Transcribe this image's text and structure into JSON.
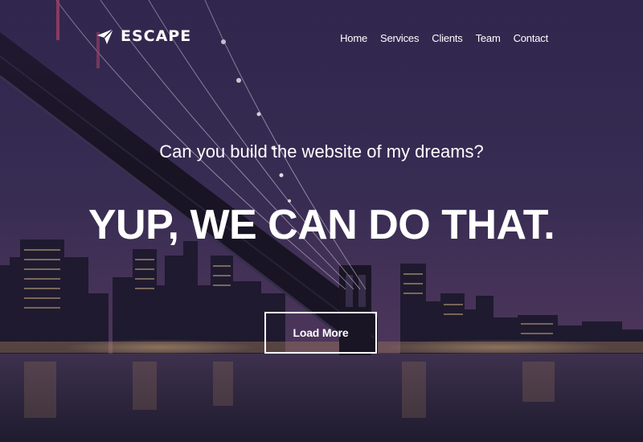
{
  "brand": {
    "name": "ESCAPE",
    "icon": "paper-plane-icon"
  },
  "nav": {
    "items": [
      {
        "label": "Home"
      },
      {
        "label": "Services"
      },
      {
        "label": "Clients"
      },
      {
        "label": "Team"
      },
      {
        "label": "Contact"
      }
    ]
  },
  "hero": {
    "subtitle": "Can you build the website of my dreams?",
    "title": "YUP, WE CAN DO THAT.",
    "cta_label": "Load More"
  },
  "colors": {
    "sky": "#2a2444",
    "sky_light": "#5a3e6e",
    "water": "#2b2640",
    "white": "#ffffff"
  }
}
